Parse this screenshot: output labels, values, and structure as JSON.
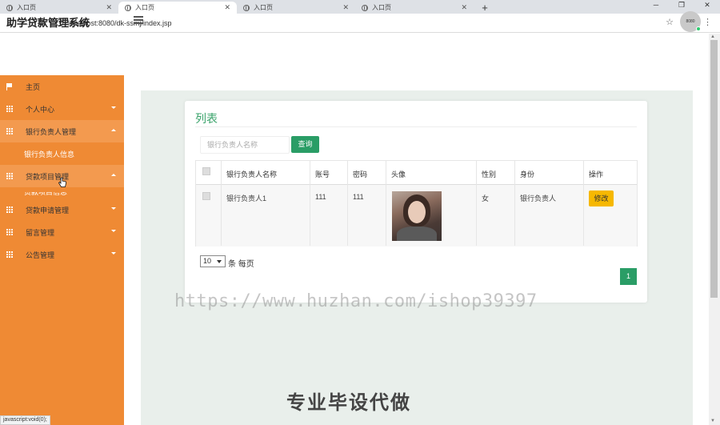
{
  "browser": {
    "tabs": [
      {
        "label": "入口页",
        "active": false
      },
      {
        "label": "入口页",
        "active": true
      },
      {
        "label": "入口页",
        "active": false
      },
      {
        "label": "入口页",
        "active": false
      }
    ],
    "url": "localhost:8080/dk-ssmj/index.jsp",
    "status_text": "javascript:void(0);"
  },
  "header": {
    "title": "助学贷款管理系统",
    "avatar_text": "8080"
  },
  "sidebar": {
    "items": [
      {
        "label": "主页"
      },
      {
        "label": "个人中心"
      },
      {
        "label": "银行负责人管理"
      },
      {
        "label": "贷款项目管理"
      },
      {
        "label": "贷款申请管理"
      },
      {
        "label": "留言管理"
      },
      {
        "label": "公告管理"
      }
    ],
    "sub_items": [
      {
        "label": "银行负责人信息"
      },
      {
        "label": "贷款项目信息"
      }
    ]
  },
  "main": {
    "card_title": "列表",
    "search": {
      "placeholder": "银行负责人名称",
      "button": "查询"
    },
    "table": {
      "columns": [
        "银行负责人名称",
        "账号",
        "密码",
        "头像",
        "性别",
        "身份",
        "操作"
      ],
      "rows": [
        {
          "name": "银行负责人1",
          "account": "111",
          "password": "111",
          "gender": "女",
          "role": "银行负责人",
          "action": "修改"
        }
      ]
    },
    "pagination": {
      "page_size": "10",
      "page_size_label": "条 每页",
      "current_page": "1"
    }
  },
  "watermarks": {
    "url": "https://www.huzhan.com/ishop39397",
    "slogan": "专业毕设代做"
  },
  "colors": {
    "sidebar": "#ef8a34",
    "accent_green": "#2a9d66",
    "edit_yellow": "#f6b800"
  }
}
